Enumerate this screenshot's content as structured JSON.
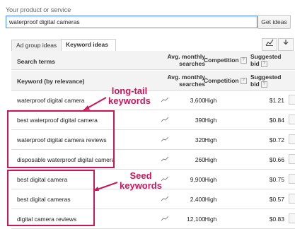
{
  "form": {
    "label": "Your product or service",
    "query": "waterproof digital cameras",
    "button": "Get ideas"
  },
  "tabs": [
    "Ad group ideas",
    "Keyword ideas"
  ],
  "table": {
    "header1": {
      "search_terms": "Search terms",
      "avg": "Avg. monthly searches",
      "competition": "Competition",
      "bid": "Suggested bid"
    },
    "header2": {
      "keyword": "Keyword (by relevance)",
      "avg": "Avg. monthly searches",
      "competition": "Competition",
      "bid": "Suggested bid"
    },
    "rows": [
      {
        "keyword": "waterproof digital camera",
        "searches": "3,600",
        "competition": "High",
        "bid": "$1.21"
      },
      {
        "keyword": "best waterproof digital camera",
        "searches": "390",
        "competition": "High",
        "bid": "$0.84"
      },
      {
        "keyword": "waterproof digital camera reviews",
        "searches": "320",
        "competition": "High",
        "bid": "$0.72"
      },
      {
        "keyword": "disposable waterproof digital camera",
        "searches": "260",
        "competition": "High",
        "bid": "$0.66"
      },
      {
        "keyword": "best digital camera",
        "searches": "9,900",
        "competition": "High",
        "bid": "$0.75"
      },
      {
        "keyword": "best digital cameras",
        "searches": "2,400",
        "competition": "High",
        "bid": "$0.57"
      },
      {
        "keyword": "digital camera reviews",
        "searches": "12,100",
        "competition": "High",
        "bid": "$0.83"
      }
    ]
  },
  "annotations": {
    "longtail": [
      "long-tail",
      "keywords"
    ],
    "seed": [
      "Seed",
      "keywords"
    ]
  },
  "colors": {
    "highlight": "#c8185b",
    "input_border": "#4d90fe"
  }
}
